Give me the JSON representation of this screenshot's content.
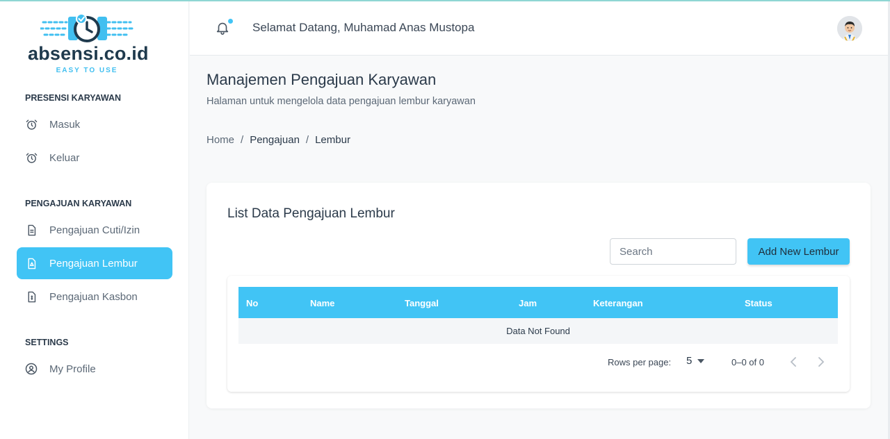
{
  "app": {
    "logo_text": "absensi.co.id",
    "logo_tagline": "EASY TO USE"
  },
  "sidebar": {
    "sections": [
      {
        "title": "PRESENSI KARYAWAN",
        "items": [
          {
            "label": "Masuk",
            "icon": "alarm-clock-icon"
          },
          {
            "label": "Keluar",
            "icon": "alarm-clock-icon"
          }
        ]
      },
      {
        "title": "PENGAJUAN KARYAWAN",
        "items": [
          {
            "label": "Pengajuan Cuti/Izin",
            "icon": "document-icon"
          },
          {
            "label": "Pengajuan Lembur",
            "icon": "document-warning-icon",
            "active": true
          },
          {
            "label": "Pengajuan Kasbon",
            "icon": "document-money-icon"
          }
        ]
      },
      {
        "title": "SETTINGS",
        "items": [
          {
            "label": "My Profile",
            "icon": "user-circle-icon"
          }
        ]
      }
    ]
  },
  "header": {
    "welcome": "Selamat Datang, Muhamad Anas Mustopa",
    "notification_icon": "bell-icon",
    "avatar": "user-avatar"
  },
  "page": {
    "title": "Manajemen Pengajuan Karyawan",
    "subtitle": "Halaman untuk mengelola data pengajuan lembur karyawan",
    "breadcrumb": [
      "Home",
      "Pengajuan",
      "Lembur"
    ],
    "breadcrumb_separator": "/"
  },
  "card": {
    "title": "List Data Pengajuan Lembur",
    "search_placeholder": "Search",
    "add_button": "Add New Lembur",
    "table": {
      "columns": [
        "No",
        "Name",
        "Tanggal",
        "Jam",
        "Keterangan",
        "Status"
      ],
      "empty_text": "Data Not Found"
    },
    "pagination": {
      "rows_per_page_label": "Rows per page:",
      "rows_per_page_value": "5",
      "range_text": "0–0 of 0"
    }
  },
  "colors": {
    "accent": "#41c4f5",
    "text_dark": "#2b3a4a",
    "text_muted": "#5b6876"
  }
}
